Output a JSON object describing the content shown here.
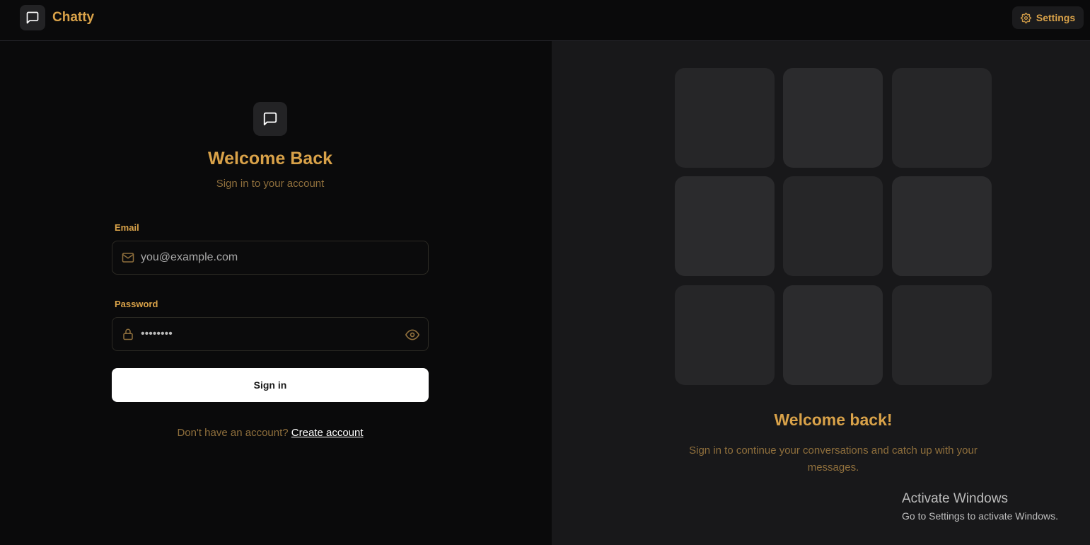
{
  "app": {
    "name": "Chatty",
    "settings_label": "Settings"
  },
  "login": {
    "title": "Welcome Back",
    "subtitle": "Sign in to your account",
    "email_label": "Email",
    "email_placeholder": "you@example.com",
    "password_label": "Password",
    "password_value": "••••••••",
    "sign_in_label": "Sign in",
    "no_account_text": "Don't have an account?",
    "create_account_label": "Create account"
  },
  "promo": {
    "title": "Welcome back!",
    "subtitle": "Sign in to continue your conversations and catch up with your messages."
  },
  "watermark": {
    "title": "Activate Windows",
    "subtitle": "Go to Settings to activate Windows."
  },
  "icons": {
    "brand": "message-square-icon",
    "settings": "gear-icon",
    "email": "mail-icon",
    "password": "lock-icon",
    "toggle": "eye-icon"
  },
  "colors": {
    "accent": "#d9a249",
    "accent_muted": "#8f6f3c",
    "background": "#0a0a0b",
    "panel": "#18181a",
    "tile": "#262628"
  }
}
